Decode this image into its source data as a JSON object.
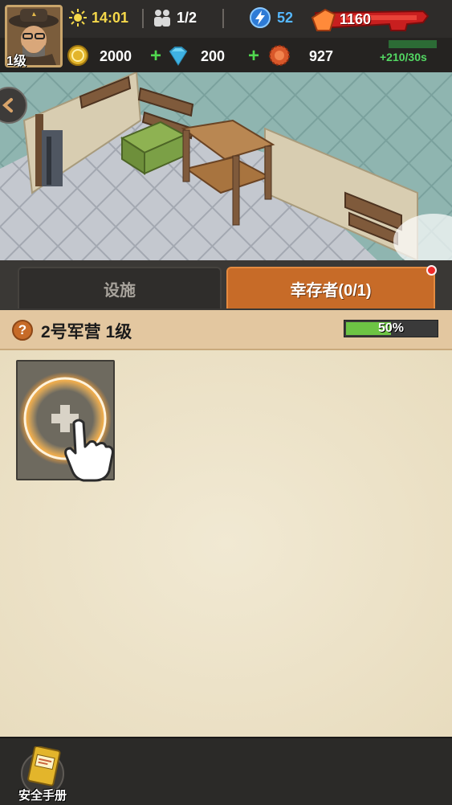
{
  "hud": {
    "player_level": "1级",
    "time": "14:01",
    "population": "1/2",
    "energy": "52",
    "power": "1160",
    "coins": "2000",
    "gems": "200",
    "bottle_caps": "927",
    "rate": "+210/30s",
    "plus_symbol": "+"
  },
  "tabs": {
    "facilities": "设施",
    "survivors": "幸存者(0/1)"
  },
  "building": {
    "help_symbol": "?",
    "title": "2号军营 1级",
    "progress_text": "50%",
    "progress_value": 0.5
  },
  "bottom": {
    "manual_label": "安全手册"
  },
  "colors": {
    "accent_orange": "#c76b28",
    "progress_green": "#6dc444",
    "time_yellow": "#f5d84a",
    "energy_blue": "#55b8ff",
    "plus_green": "#51d84f"
  }
}
